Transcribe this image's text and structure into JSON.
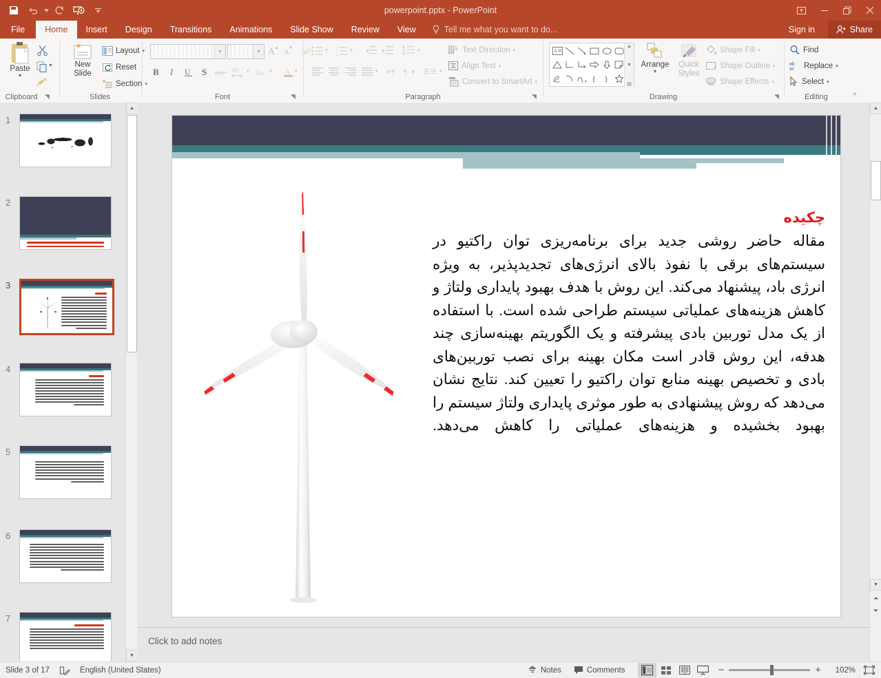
{
  "titlebar": {
    "document_title": "powerpoint.pptx - PowerPoint",
    "quick_access": [
      {
        "name": "save-icon",
        "label": "Save"
      },
      {
        "name": "undo-icon",
        "label": "Undo"
      },
      {
        "name": "redo-icon",
        "label": "Redo"
      },
      {
        "name": "start-presentation-icon",
        "label": "Start From Beginning"
      },
      {
        "name": "customize-qat-icon",
        "label": "Customize Quick Access Toolbar"
      }
    ],
    "window_controls": [
      {
        "name": "ribbon-display-options-icon",
        "label": "Ribbon Display Options"
      },
      {
        "name": "minimize-icon",
        "label": "Minimize"
      },
      {
        "name": "restore-icon",
        "label": "Restore Down"
      },
      {
        "name": "close-icon",
        "label": "Close"
      }
    ]
  },
  "ribbon": {
    "tabs": [
      {
        "label": "File",
        "active": false
      },
      {
        "label": "Home",
        "active": true
      },
      {
        "label": "Insert",
        "active": false
      },
      {
        "label": "Design",
        "active": false
      },
      {
        "label": "Transitions",
        "active": false
      },
      {
        "label": "Animations",
        "active": false
      },
      {
        "label": "Slide Show",
        "active": false
      },
      {
        "label": "Review",
        "active": false
      },
      {
        "label": "View",
        "active": false
      }
    ],
    "tell_me": "Tell me what you want to do...",
    "sign_in": "Sign in",
    "share": "Share",
    "groups": {
      "clipboard": {
        "label": "Clipboard",
        "paste": "Paste",
        "cut": "Cut",
        "copy": "Copy",
        "format_painter": "Format Painter"
      },
      "slides": {
        "label": "Slides",
        "new_slide": "New\nSlide",
        "new_slide_line1": "New",
        "new_slide_line2": "Slide",
        "layout": "Layout",
        "reset": "Reset",
        "section": "Section"
      },
      "font": {
        "label": "Font",
        "font_name_value": "",
        "font_size_value": "",
        "increase_font": "Increase Font Size",
        "decrease_font": "Decrease Font Size",
        "clear_formatting": "Clear All Formatting",
        "bold": "B",
        "italic": "I",
        "underline": "U",
        "shadow": "S",
        "strikethrough": "abc",
        "character_spacing": "AV",
        "change_case": "Aa",
        "font_color": "A"
      },
      "paragraph": {
        "label": "Paragraph",
        "text_direction": "Text Direction",
        "align_text": "Align Text",
        "convert_to_smartart": "Convert to SmartArt"
      },
      "drawing": {
        "label": "Drawing",
        "arrange": "Arrange",
        "quick_styles_line1": "Quick",
        "quick_styles_line2": "Styles",
        "shape_fill": "Shape Fill",
        "shape_outline": "Shape Outline",
        "shape_effects": "Shape Effects"
      },
      "editing": {
        "label": "Editing",
        "find": "Find",
        "replace": "Replace",
        "select": "Select"
      }
    }
  },
  "thumbnails": {
    "selected_index": 3,
    "items": [
      {
        "number": "1",
        "kind": "calligraphy"
      },
      {
        "number": "2",
        "kind": "title"
      },
      {
        "number": "3",
        "kind": "turbine-abstract"
      },
      {
        "number": "4",
        "kind": "text"
      },
      {
        "number": "5",
        "kind": "text"
      },
      {
        "number": "6",
        "kind": "text"
      },
      {
        "number": "7",
        "kind": "text"
      }
    ]
  },
  "slide": {
    "heading": "چکیده",
    "body": "مقاله حاضر روشی جدید برای برنامه‌ریزی توان راکتیو در سیستم‌های برقی با نفوذ بالای انرژی‌های تجدیدپذیر، به ویژه انرژی باد، پیشنهاد می‌کند. این روش با هدف بهبود پایداری ولتاژ و کاهش هزینه‌های عملیاتی سیستم طراحی شده است. با استفاده از یک مدل توربین بادی پیشرفته و یک الگوریتم بهینه‌سازی چند هدفه، این روش قادر است مکان بهینه برای نصب توربین‌های بادی و تخصیص بهینه منابع توان راکتیو را تعیین کند. نتایج نشان می‌دهد که روش پیشنهادی به طور موثری پایداری ولتاژ سیستم را بهبود بخشیده و هزینه‌های عملیاتی را کاهش می‌دهد.",
    "image_name": "wind-turbine-image",
    "colors": {
      "band_dark": "#3e4155",
      "band_teal": "#3a7b81",
      "band_light": "#a5c2c6",
      "heading_red": "#e8161a"
    }
  },
  "notes": {
    "placeholder": "Click to add notes"
  },
  "status_bar": {
    "slide_indicator": "Slide 3 of 17",
    "language": "English (United States)",
    "spellcheck_icon": "proofing-icon",
    "notes_button": "Notes",
    "comments_button": "Comments",
    "views": [
      {
        "name": "normal-view-button",
        "label": "Normal",
        "active": true
      },
      {
        "name": "slide-sorter-view-button",
        "label": "Slide Sorter",
        "active": false
      },
      {
        "name": "reading-view-button",
        "label": "Reading View",
        "active": false
      },
      {
        "name": "slide-show-button",
        "label": "Slide Show",
        "active": false
      }
    ],
    "zoom_out": "−",
    "zoom_in": "+",
    "zoom_level": "102%",
    "fit_slide": "Fit slide to current window"
  }
}
